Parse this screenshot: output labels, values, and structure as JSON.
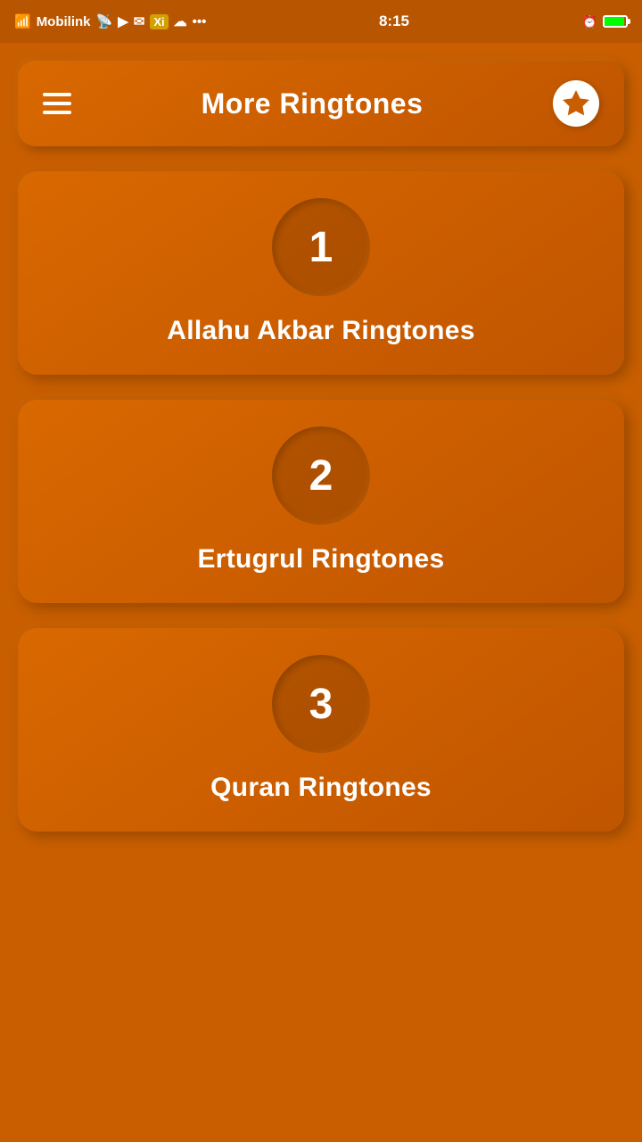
{
  "statusBar": {
    "carrier": "Mobilink",
    "time": "8:15"
  },
  "header": {
    "title": "More Ringtones",
    "starLabel": "favorites"
  },
  "cards": [
    {
      "number": "1",
      "label": "Allahu Akbar Ringtones"
    },
    {
      "number": "2",
      "label": "Ertugrul Ringtones"
    },
    {
      "number": "3",
      "label": "Quran Ringtones"
    }
  ]
}
